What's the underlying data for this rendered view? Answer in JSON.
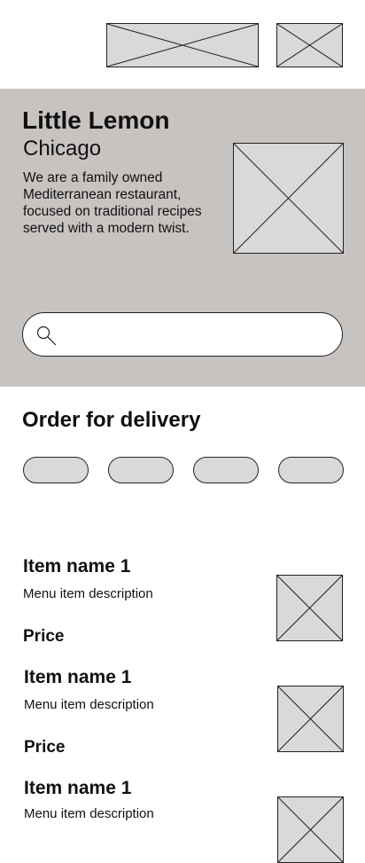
{
  "header": {
    "logo_icon": "image-placeholder-icon",
    "basket_icon": "image-placeholder-icon"
  },
  "hero": {
    "title": "Little Lemon",
    "subtitle": "Chicago",
    "description": "We are a family owned Mediterranean restaurant, focused on traditional recipes served with a modern twist.",
    "image_icon": "image-placeholder-icon",
    "background_color": "#c7c3c1"
  },
  "search": {
    "icon": "search-icon",
    "value": ""
  },
  "delivery": {
    "title": "Order for delivery",
    "categories": [
      {
        "label": ""
      },
      {
        "label": ""
      },
      {
        "label": ""
      },
      {
        "label": ""
      }
    ]
  },
  "menu": {
    "items": [
      {
        "name": "Item name 1",
        "description": "Menu item description",
        "price": "Price"
      },
      {
        "name": "Item name 1",
        "description": "Menu item description",
        "price": "Price"
      },
      {
        "name": "Item name 1",
        "description": "Menu item description",
        "price": ""
      }
    ]
  }
}
